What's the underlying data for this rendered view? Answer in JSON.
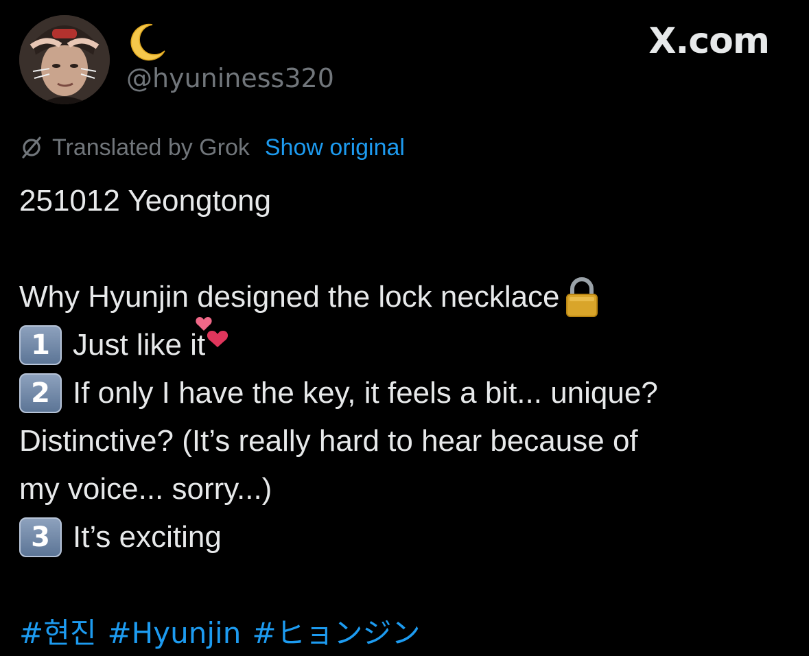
{
  "author": {
    "display_name_icon": "crescent-moon-emoji",
    "handle": "@hyuniness320"
  },
  "brand": {
    "label": "X.com"
  },
  "translation": {
    "icon": "translate-slash-icon",
    "label": "Translated by Grok",
    "show_original_label": "Show original"
  },
  "post": {
    "line1": "251012 Yeongtong",
    "line2": "Why Hyunjin designed the lock necklace",
    "item1_num": "1",
    "item1_text": "Just like it",
    "item2_num": "2",
    "item2_text": "If only I have the key, it feels a bit... unique?",
    "item2_cont1": "Distinctive? (It’s really hard to hear because of",
    "item2_cont2": "my voice... sorry...)",
    "item3_num": "3",
    "item3_text": "It’s exciting",
    "hashtags": [
      "#현진",
      "#Hyunjin",
      "#ヒョンジン"
    ]
  },
  "colors": {
    "background": "#000000",
    "text": "#e7e9ea",
    "muted": "#71767b",
    "link": "#1d9bf0"
  }
}
